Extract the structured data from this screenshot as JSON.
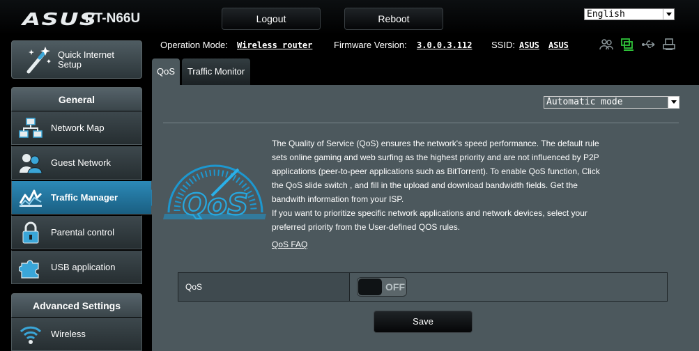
{
  "header": {
    "brand": "ASUS",
    "model": "RT-N66U",
    "logout_label": "Logout",
    "reboot_label": "Reboot",
    "language": "English"
  },
  "status": {
    "operation_mode_label": "Operation Mode:",
    "operation_mode_value": "Wireless router",
    "firmware_label": "Firmware Version:",
    "firmware_value": "3.0.0.3.112",
    "ssid_label": "SSID:",
    "ssid_values": [
      "ASUS",
      "ASUS"
    ],
    "icons": [
      "clients-icon",
      "network-icon",
      "usb-icon",
      "printer-icon"
    ]
  },
  "sidebar": {
    "quick_setup": "Quick Internet Setup",
    "general_heading": "General",
    "items": [
      {
        "label": "Network Map",
        "icon": "network-map-icon"
      },
      {
        "label": "Guest Network",
        "icon": "guest-network-icon"
      },
      {
        "label": "Traffic Manager",
        "icon": "traffic-manager-icon",
        "active": true
      },
      {
        "label": "Parental control",
        "icon": "lock-icon"
      },
      {
        "label": "USB application",
        "icon": "puzzle-icon"
      }
    ],
    "advanced_heading": "Advanced Settings",
    "advanced_items": [
      {
        "label": "Wireless",
        "icon": "wireless-icon"
      }
    ]
  },
  "tabs": [
    {
      "label": "QoS",
      "active": true
    },
    {
      "label": "Traffic Monitor",
      "active": false
    }
  ],
  "main": {
    "mode_select": "Automatic mode",
    "description_lines": [
      "The Quality of Service (QoS) ensures the network's speed performance. The default rule",
      "sets online gaming and web surfing as the highest priority and are not influenced by P2P",
      "applications (peer-to-peer applications such as BitTorrent). To enable QoS function, Click",
      "the QoS slide switch , and fill in the upload and download bandwidth fields. Get the",
      "bandwith information from your ISP.",
      "If you want to prioritize specific network applications and network devices, select your",
      "preferred priority from the User-defined QOS rules."
    ],
    "faq_link": "QoS FAQ",
    "qos_label": "QoS",
    "qos_toggle_state": "OFF",
    "save_label": "Save",
    "logo_text": "QoS"
  },
  "colors": {
    "accent": "#2a84b4",
    "panel": "#4c585d",
    "header_bg": "#000000"
  }
}
